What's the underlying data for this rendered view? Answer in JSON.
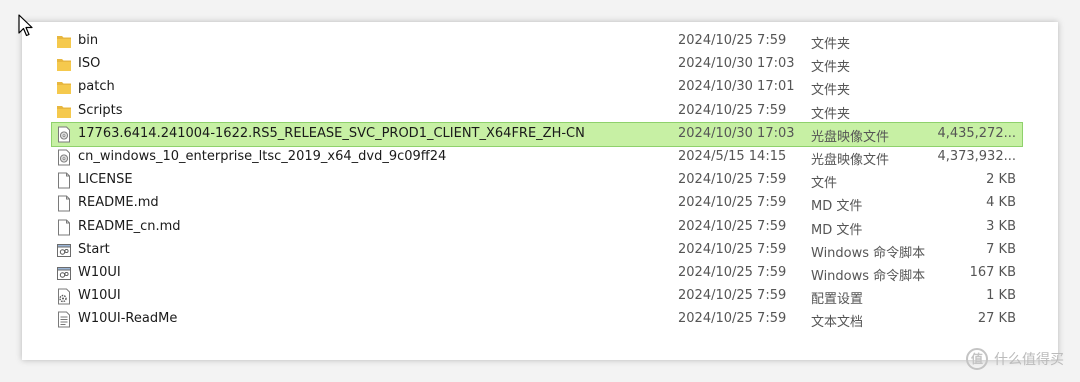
{
  "files": [
    {
      "name": "bin",
      "date": "2024/10/25 7:59",
      "type": "文件夹",
      "size": "",
      "icon": "folder-icon",
      "selected": false
    },
    {
      "name": "ISO",
      "date": "2024/10/30 17:03",
      "type": "文件夹",
      "size": "",
      "icon": "folder-icon",
      "selected": false
    },
    {
      "name": "patch",
      "date": "2024/10/30 17:01",
      "type": "文件夹",
      "size": "",
      "icon": "folder-icon",
      "selected": false
    },
    {
      "name": "Scripts",
      "date": "2024/10/25 7:59",
      "type": "文件夹",
      "size": "",
      "icon": "folder-icon",
      "selected": false
    },
    {
      "name": "17763.6414.241004-1622.RS5_RELEASE_SVC_PROD1_CLIENT_X64FRE_ZH-CN",
      "date": "2024/10/30 17:03",
      "type": "光盘映像文件",
      "size": "4,435,272...",
      "icon": "disc-image-icon",
      "selected": true
    },
    {
      "name": "cn_windows_10_enterprise_ltsc_2019_x64_dvd_9c09ff24",
      "date": "2024/5/15 14:15",
      "type": "光盘映像文件",
      "size": "4,373,932...",
      "icon": "disc-image-icon",
      "selected": false
    },
    {
      "name": "LICENSE",
      "date": "2024/10/25 7:59",
      "type": "文件",
      "size": "2 KB",
      "icon": "blank-file-icon",
      "selected": false
    },
    {
      "name": "README.md",
      "date": "2024/10/25 7:59",
      "type": "MD 文件",
      "size": "4 KB",
      "icon": "blank-file-icon",
      "selected": false
    },
    {
      "name": "README_cn.md",
      "date": "2024/10/25 7:59",
      "type": "MD 文件",
      "size": "3 KB",
      "icon": "blank-file-icon",
      "selected": false
    },
    {
      "name": "Start",
      "date": "2024/10/25 7:59",
      "type": "Windows 命令脚本",
      "size": "7 KB",
      "icon": "batch-script-icon",
      "selected": false
    },
    {
      "name": "W10UI",
      "date": "2024/10/25 7:59",
      "type": "Windows 命令脚本",
      "size": "167 KB",
      "icon": "batch-script-icon",
      "selected": false
    },
    {
      "name": "W10UI",
      "date": "2024/10/25 7:59",
      "type": "配置设置",
      "size": "1 KB",
      "icon": "config-settings-icon",
      "selected": false
    },
    {
      "name": "W10UI-ReadMe",
      "date": "2024/10/25 7:59",
      "type": "文本文档",
      "size": "27 KB",
      "icon": "text-document-icon",
      "selected": false
    }
  ],
  "watermark": {
    "badge": "值",
    "text": "什么值得买"
  }
}
